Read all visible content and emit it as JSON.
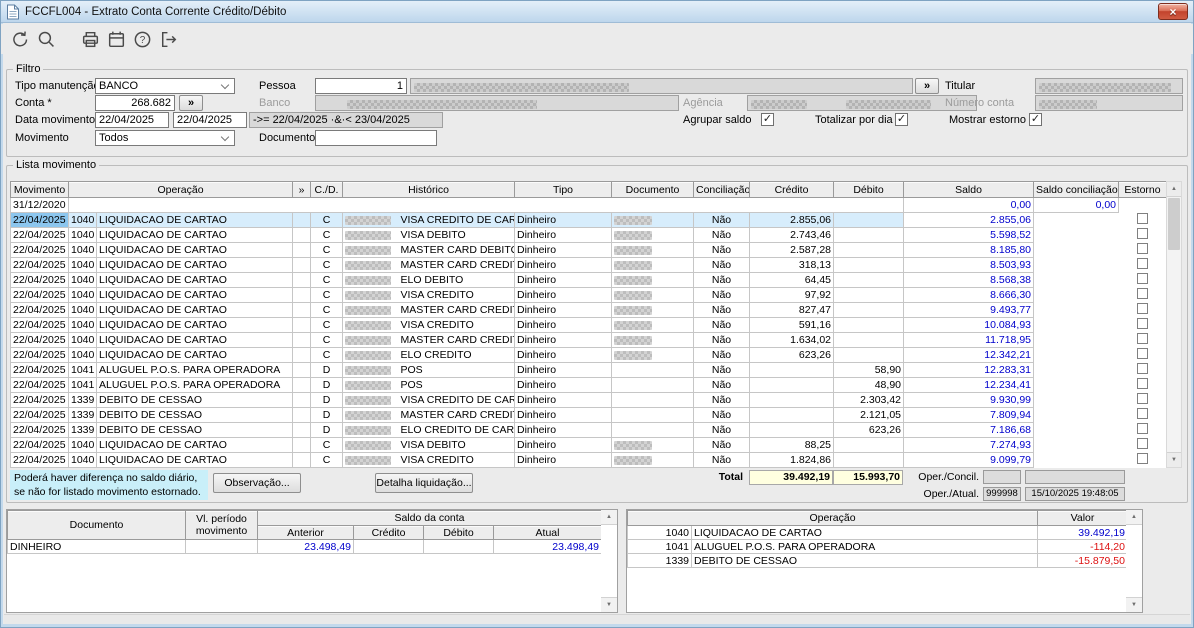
{
  "window": {
    "title": "FCCFL004 - Extrato Conta Corrente Crédito/Débito"
  },
  "toolbar": {
    "buttons": [
      "undo",
      "search",
      "print",
      "calendar",
      "help",
      "exit"
    ]
  },
  "colors": {
    "value_blue": "#0000cc",
    "value_red": "#dd1111",
    "selection": "#d7edfc",
    "note_bg": "#c9eff9",
    "total_bg": "#ffffe0"
  },
  "filter": {
    "legend": "Filtro",
    "tipo_manutencao": {
      "label": "Tipo manutenção",
      "value": "BANCO"
    },
    "pessoa": {
      "label": "Pessoa",
      "code": "1"
    },
    "titular": {
      "label": "Titular"
    },
    "conta": {
      "label": "Conta *",
      "value": "268.682",
      "more_button": "»"
    },
    "banco": {
      "label": "Banco"
    },
    "agencia": {
      "label": "Agência"
    },
    "numero_conta": {
      "label": "Número conta"
    },
    "data_movimento": {
      "label": "Data movimento *",
      "from": "22/04/2025",
      "to": "22/04/2025",
      "expression": "->= 22/04/2025 ·&·< 23/04/2025"
    },
    "checkboxes": [
      {
        "label": "Agrupar saldo",
        "checked": true
      },
      {
        "label": "Totalizar por dia",
        "checked": true
      },
      {
        "label": "Mostrar estorno",
        "checked": true
      }
    ],
    "movimento": {
      "label": "Movimento",
      "value": "Todos"
    },
    "documento": {
      "label": "Documento",
      "value": ""
    }
  },
  "lista": {
    "legend": "Lista movimento",
    "columns": [
      "Movimento",
      "Operação",
      "»",
      "C./D.",
      "Histórico",
      "Tipo",
      "Documento",
      "Conciliação",
      "Crédito",
      "Débito",
      "Saldo",
      "Saldo conciliação",
      "Estorno"
    ],
    "rows": [
      {
        "movimento": "31/12/2020",
        "op_code": "",
        "op_name": "",
        "cd": "",
        "historico": "",
        "tipo": "",
        "conciliacao": "",
        "credito": "",
        "debito": "",
        "saldo": "0,00",
        "saldo_conc": "0,00",
        "hist_redacted": false,
        "doc_redacted": false,
        "selected": false
      },
      {
        "movimento": "22/04/2025",
        "op_code": "1040",
        "op_name": "LIQUIDACAO DE CARTAO",
        "cd": "C",
        "historico": "VISA CREDITO DE CARTAC",
        "tipo": "Dinheiro",
        "conciliacao": "Não",
        "credito": "2.855,06",
        "debito": "",
        "saldo": "2.855,06",
        "saldo_conc": "",
        "hist_redacted": true,
        "doc_redacted": true,
        "selected": true
      },
      {
        "movimento": "22/04/2025",
        "op_code": "1040",
        "op_name": "LIQUIDACAO DE CARTAO",
        "cd": "C",
        "historico": "VISA DEBITO",
        "tipo": "Dinheiro",
        "conciliacao": "Não",
        "credito": "2.743,46",
        "debito": "",
        "saldo": "5.598,52",
        "saldo_conc": "",
        "hist_redacted": true,
        "doc_redacted": true,
        "selected": false
      },
      {
        "movimento": "22/04/2025",
        "op_code": "1040",
        "op_name": "LIQUIDACAO DE CARTAO",
        "cd": "C",
        "historico": "MASTER CARD DEBITO",
        "tipo": "Dinheiro",
        "conciliacao": "Não",
        "credito": "2.587,28",
        "debito": "",
        "saldo": "8.185,80",
        "saldo_conc": "",
        "hist_redacted": true,
        "doc_redacted": true,
        "selected": false
      },
      {
        "movimento": "22/04/2025",
        "op_code": "1040",
        "op_name": "LIQUIDACAO DE CARTAO",
        "cd": "C",
        "historico": "MASTER CARD CREDITO D",
        "tipo": "Dinheiro",
        "conciliacao": "Não",
        "credito": "318,13",
        "debito": "",
        "saldo": "8.503,93",
        "saldo_conc": "",
        "hist_redacted": true,
        "doc_redacted": true,
        "selected": false
      },
      {
        "movimento": "22/04/2025",
        "op_code": "1040",
        "op_name": "LIQUIDACAO DE CARTAO",
        "cd": "C",
        "historico": "ELO DEBITO",
        "tipo": "Dinheiro",
        "conciliacao": "Não",
        "credito": "64,45",
        "debito": "",
        "saldo": "8.568,38",
        "saldo_conc": "",
        "hist_redacted": true,
        "doc_redacted": true,
        "selected": false
      },
      {
        "movimento": "22/04/2025",
        "op_code": "1040",
        "op_name": "LIQUIDACAO DE CARTAO",
        "cd": "C",
        "historico": "VISA CREDITO",
        "tipo": "Dinheiro",
        "conciliacao": "Não",
        "credito": "97,92",
        "debito": "",
        "saldo": "8.666,30",
        "saldo_conc": "",
        "hist_redacted": true,
        "doc_redacted": true,
        "selected": false
      },
      {
        "movimento": "22/04/2025",
        "op_code": "1040",
        "op_name": "LIQUIDACAO DE CARTAO",
        "cd": "C",
        "historico": "MASTER CARD CREDITO",
        "tipo": "Dinheiro",
        "conciliacao": "Não",
        "credito": "827,47",
        "debito": "",
        "saldo": "9.493,77",
        "saldo_conc": "",
        "hist_redacted": true,
        "doc_redacted": true,
        "selected": false
      },
      {
        "movimento": "22/04/2025",
        "op_code": "1040",
        "op_name": "LIQUIDACAO DE CARTAO",
        "cd": "C",
        "historico": "VISA CREDITO",
        "tipo": "Dinheiro",
        "conciliacao": "Não",
        "credito": "591,16",
        "debito": "",
        "saldo": "10.084,93",
        "saldo_conc": "",
        "hist_redacted": true,
        "doc_redacted": true,
        "selected": false
      },
      {
        "movimento": "22/04/2025",
        "op_code": "1040",
        "op_name": "LIQUIDACAO DE CARTAO",
        "cd": "C",
        "historico": "MASTER CARD CREDITO",
        "tipo": "Dinheiro",
        "conciliacao": "Não",
        "credito": "1.634,02",
        "debito": "",
        "saldo": "11.718,95",
        "saldo_conc": "",
        "hist_redacted": true,
        "doc_redacted": true,
        "selected": false
      },
      {
        "movimento": "22/04/2025",
        "op_code": "1040",
        "op_name": "LIQUIDACAO DE CARTAO",
        "cd": "C",
        "historico": "ELO CREDITO",
        "tipo": "Dinheiro",
        "conciliacao": "Não",
        "credito": "623,26",
        "debito": "",
        "saldo": "12.342,21",
        "saldo_conc": "",
        "hist_redacted": true,
        "doc_redacted": true,
        "selected": false
      },
      {
        "movimento": "22/04/2025",
        "op_code": "1041",
        "op_name": "ALUGUEL P.O.S. PARA OPERADORA",
        "cd": "D",
        "historico": "POS",
        "tipo": "Dinheiro",
        "conciliacao": "Não",
        "credito": "",
        "debito": "58,90",
        "saldo": "12.283,31",
        "saldo_conc": "",
        "hist_redacted": true,
        "doc_redacted": false,
        "selected": false
      },
      {
        "movimento": "22/04/2025",
        "op_code": "1041",
        "op_name": "ALUGUEL P.O.S. PARA OPERADORA",
        "cd": "D",
        "historico": "POS",
        "tipo": "Dinheiro",
        "conciliacao": "Não",
        "credito": "",
        "debito": "48,90",
        "saldo": "12.234,41",
        "saldo_conc": "",
        "hist_redacted": true,
        "doc_redacted": false,
        "selected": false
      },
      {
        "movimento": "22/04/2025",
        "op_code": "1339",
        "op_name": "DEBITO DE CESSAO",
        "cd": "D",
        "historico": "VISA CREDITO DE CARTAC",
        "tipo": "Dinheiro",
        "conciliacao": "Não",
        "credito": "",
        "debito": "2.303,42",
        "saldo": "9.930,99",
        "saldo_conc": "",
        "hist_redacted": true,
        "doc_redacted": false,
        "selected": false
      },
      {
        "movimento": "22/04/2025",
        "op_code": "1339",
        "op_name": "DEBITO DE CESSAO",
        "cd": "D",
        "historico": "MASTER CARD CREDITO",
        "tipo": "Dinheiro",
        "conciliacao": "Não",
        "credito": "",
        "debito": "2.121,05",
        "saldo": "7.809,94",
        "saldo_conc": "",
        "hist_redacted": true,
        "doc_redacted": false,
        "selected": false
      },
      {
        "movimento": "22/04/2025",
        "op_code": "1339",
        "op_name": "DEBITO DE CESSAO",
        "cd": "D",
        "historico": "ELO CREDITO DE CARTAO",
        "tipo": "Dinheiro",
        "conciliacao": "Não",
        "credito": "",
        "debito": "623,26",
        "saldo": "7.186,68",
        "saldo_conc": "",
        "hist_redacted": true,
        "doc_redacted": false,
        "selected": false
      },
      {
        "movimento": "22/04/2025",
        "op_code": "1040",
        "op_name": "LIQUIDACAO DE CARTAO",
        "cd": "C",
        "historico": "VISA DEBITO",
        "tipo": "Dinheiro",
        "conciliacao": "Não",
        "credito": "88,25",
        "debito": "",
        "saldo": "7.274,93",
        "saldo_conc": "",
        "hist_redacted": true,
        "doc_redacted": true,
        "selected": false
      },
      {
        "movimento": "22/04/2025",
        "op_code": "1040",
        "op_name": "LIQUIDACAO DE CARTAO",
        "cd": "C",
        "historico": "VISA CREDITO",
        "tipo": "Dinheiro",
        "conciliacao": "Não",
        "credito": "1.824,86",
        "debito": "",
        "saldo": "9.099,79",
        "saldo_conc": "",
        "hist_redacted": true,
        "doc_redacted": true,
        "selected": false
      }
    ],
    "note": [
      "Poderá haver diferença no saldo diário,",
      "se não for listado movimento estornado."
    ],
    "observacao_button": "Observação...",
    "detalha_button": "Detalha liquidação...",
    "total_label": "Total",
    "total_credito": "39.492,19",
    "total_debito": "15.993,70",
    "oper_concil_label": "Oper./Concil.",
    "oper_atual_label": "Oper./Atual.",
    "oper_atual_code": "999998",
    "oper_atual_datetime": "15/10/2025 19:48:05"
  },
  "documento_panel": {
    "headers": {
      "documento": "Documento",
      "vl_periodo": [
        "Vl. período",
        "movimento"
      ],
      "saldo_conta": "Saldo da conta",
      "sub": [
        "Anterior",
        "Crédito",
        "Débito",
        "Atual"
      ]
    },
    "rows": [
      {
        "documento": "DINHEIRO",
        "vl_periodo": "",
        "anterior": "23.498,49",
        "credito": "",
        "debito": "",
        "atual": "23.498,49"
      }
    ]
  },
  "operacao_panel": {
    "headers": {
      "operacao": "Operação",
      "valor": "Valor"
    },
    "rows": [
      {
        "code": "1040",
        "name": "LIQUIDACAO DE CARTAO",
        "valor": "39.492,19",
        "negative": false
      },
      {
        "code": "1041",
        "name": "ALUGUEL P.O.S. PARA OPERADORA",
        "valor": "-114,20",
        "negative": true
      },
      {
        "code": "1339",
        "name": "DEBITO DE CESSAO",
        "valor": "-15.879,50",
        "negative": true
      }
    ]
  }
}
